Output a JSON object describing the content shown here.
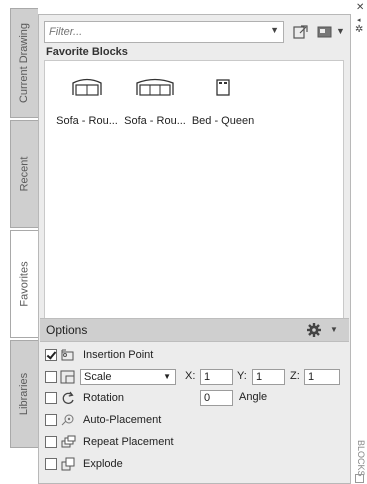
{
  "tabs": [
    {
      "label": "Current Drawing"
    },
    {
      "label": "Recent"
    },
    {
      "label": "Favorites"
    },
    {
      "label": "Libraries"
    }
  ],
  "filter": {
    "placeholder": "Filter..."
  },
  "section_title": "Favorite Blocks",
  "blocks": [
    {
      "label": "Sofa - Rou..."
    },
    {
      "label": "Sofa - Rou..."
    },
    {
      "label": "Bed - Queen"
    }
  ],
  "options": {
    "title": "Options",
    "insertion_point": {
      "label": "Insertion Point",
      "checked": true
    },
    "scale": {
      "label": "Scale",
      "checked": false,
      "x_label": "X:",
      "x_value": "1",
      "y_label": "Y:",
      "y_value": "1",
      "z_label": "Z:",
      "z_value": "1"
    },
    "rotation": {
      "label": "Rotation",
      "checked": false,
      "value": "0",
      "unit_label": "Angle"
    },
    "auto_placement": {
      "label": "Auto-Placement",
      "checked": false
    },
    "repeat_placement": {
      "label": "Repeat Placement",
      "checked": false
    },
    "explode": {
      "label": "Explode",
      "checked": false
    }
  },
  "right_strip": {
    "label": "BLOCKS"
  }
}
